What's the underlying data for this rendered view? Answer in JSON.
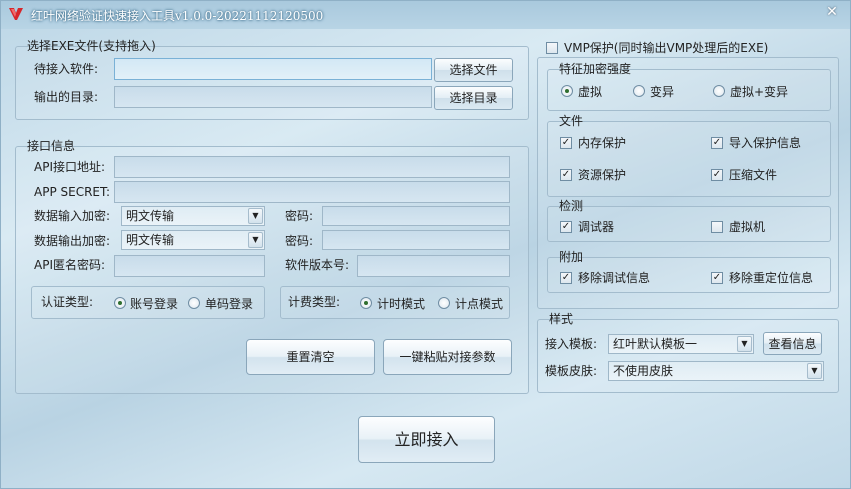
{
  "window": {
    "title": "红叶网络验证快速接入工具v1.0.0-20221112120500",
    "close_glyph": "✕"
  },
  "file_group": {
    "title": "选择EXE文件(支持拖入)",
    "software_label": "待接入软件:",
    "software_value": "",
    "output_label": "输出的目录:",
    "output_value": "",
    "select_file_button": "选择文件",
    "select_dir_button": "选择目录"
  },
  "api_group": {
    "title": "接口信息",
    "api_url_label": "API接口地址:",
    "api_url_value": "",
    "app_secret_label": "APP SECRET:",
    "app_secret_value": "",
    "input_encrypt_label": "数据输入加密:",
    "input_encrypt_value": "明文传输",
    "output_encrypt_label": "数据输出加密:",
    "output_encrypt_value": "明文传输",
    "password_label_1": "密码:",
    "password_value_1": "",
    "password_label_2": "密码:",
    "password_value_2": "",
    "sign_password_label": "API匿名密码:",
    "sign_password_value": "",
    "version_label": "软件版本号:",
    "version_value": "",
    "auth_type_label": "认证类型:",
    "auth_account": "账号登录",
    "auth_single": "单码登录",
    "billing_type_label": "计费类型:",
    "billing_time": "计时模式",
    "billing_point": "计点模式",
    "reset_button": "重置清空",
    "paste_button": "一键粘贴对接参数"
  },
  "vmp": {
    "label": "VMP保护(同时输出VMP处理后的EXE)",
    "checked": false
  },
  "strength_group": {
    "title": "特征加密强度",
    "opt_virtual": "虚拟",
    "opt_mutate": "变异",
    "opt_both": "虚拟+变异",
    "selected": "虚拟"
  },
  "file_opts_group": {
    "title": "文件",
    "memory_protect": "内存保护",
    "import_protect": "导入保护信息",
    "resource_protect": "资源保护",
    "compress_file": "压缩文件"
  },
  "detect_group": {
    "title": "检测",
    "debugger": "调试器",
    "vm": "虚拟机"
  },
  "extra_group": {
    "title": "附加",
    "remove_debug": "移除调试信息",
    "remove_reloc": "移除重定位信息"
  },
  "style_group": {
    "title": "样式",
    "template_label": "接入模板:",
    "template_value": "红叶默认模板一",
    "view_info_button": "查看信息",
    "skin_label": "模板皮肤:",
    "skin_value": "不使用皮肤"
  },
  "connect_button": "立即接入",
  "checks": {
    "memory_protect": "✓",
    "import_protect": "✓",
    "resource_protect": "✓",
    "compress_file": "✓",
    "debugger": "✓",
    "vm": "",
    "remove_debug": "✓",
    "remove_reloc": "✓",
    "vmp": ""
  },
  "combo_arrow": "▼",
  "colors": {
    "accent_red": "#d6262b",
    "title_text": "#ffffff"
  }
}
